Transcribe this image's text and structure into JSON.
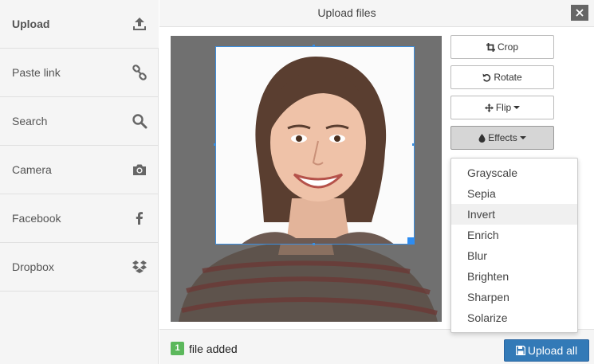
{
  "header": {
    "title": "Upload files",
    "close_icon": "close-icon"
  },
  "sidebar": {
    "items": [
      {
        "label": "Upload",
        "icon": "upload-icon",
        "active": true
      },
      {
        "label": "Paste link",
        "icon": "link-icon",
        "active": false
      },
      {
        "label": "Search",
        "icon": "search-icon",
        "active": false
      },
      {
        "label": "Camera",
        "icon": "camera-icon",
        "active": false
      },
      {
        "label": "Facebook",
        "icon": "facebook-icon",
        "active": false
      },
      {
        "label": "Dropbox",
        "icon": "dropbox-icon",
        "active": false
      }
    ]
  },
  "editor": {
    "buttons": [
      {
        "label": "Crop",
        "icon": "crop-icon"
      },
      {
        "label": "Rotate",
        "icon": "rotate-icon"
      },
      {
        "label": "Flip",
        "icon": "move-icon"
      },
      {
        "label": "Effects",
        "icon": "drop-icon"
      }
    ],
    "effects_menu": [
      "Grayscale",
      "Sepia",
      "Invert",
      "Enrich",
      "Blur",
      "Brighten",
      "Sharpen",
      "Solarize"
    ],
    "hovered_effect": "Invert"
  },
  "footer": {
    "count": "1",
    "count_label": "file added",
    "upload_label": "Upload all"
  },
  "colors": {
    "accent": "#337ab7",
    "badge": "#5cb85c",
    "crop_border": "#3b8fe0"
  }
}
